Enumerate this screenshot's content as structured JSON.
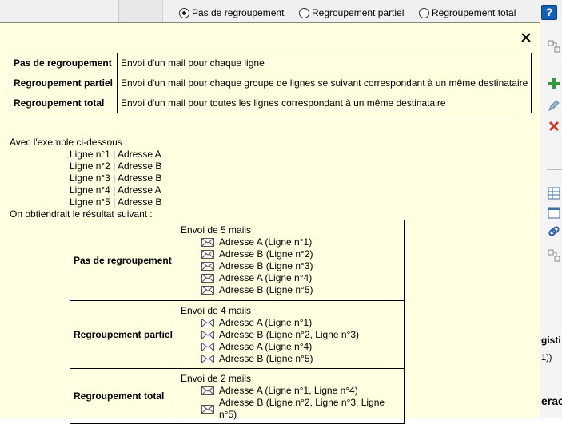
{
  "app": {
    "radios": [
      {
        "label": "Pas de regroupement",
        "checked": true
      },
      {
        "label": "Regroupement partiel",
        "checked": false
      },
      {
        "label": "Regroupement total",
        "checked": false
      }
    ],
    "help_label": "?",
    "right_text": {
      "a": "gisti",
      "b": "1))",
      "c": "erac"
    }
  },
  "tooltip": {
    "definitions": [
      {
        "key": "Pas de regroupement",
        "value": "Envoi d'un mail pour chaque ligne"
      },
      {
        "key": "Regroupement partiel",
        "value": "Envoi d'un mail pour chaque groupe de lignes se suivant correspondant à un même destinataire"
      },
      {
        "key": "Regroupement total",
        "value": "Envoi d'un mail pour toutes les lignes correspondant à un même destinataire"
      }
    ],
    "example_intro": "Avec l'exemple ci-dessous :",
    "example_lines": [
      "Ligne n°1 | Adresse A",
      "Ligne n°2 | Adresse B",
      "Ligne n°3 | Adresse B",
      "Ligne n°4 | Adresse A",
      "Ligne n°5 | Adresse B"
    ],
    "result_intro": "On obtiendrait le résultat suivant :",
    "results": [
      {
        "key": "Pas de regroupement",
        "title": "Envoi de 5 mails",
        "mails": [
          "Adresse A (Ligne n°1)",
          "Adresse B (Ligne n°2)",
          "Adresse B (Ligne n°3)",
          "Adresse A (Ligne n°4)",
          "Adresse B (Ligne n°5)"
        ]
      },
      {
        "key": "Regroupement partiel",
        "title": "Envoi de 4 mails",
        "mails": [
          "Adresse A (Ligne n°1)",
          "Adresse B (Ligne n°2, Ligne n°3)",
          "Adresse A (Ligne n°4)",
          "Adresse B (Ligne n°5)"
        ]
      },
      {
        "key": "Regroupement total",
        "title": "Envoi de 2 mails",
        "mails": [
          "Adresse A (Ligne n°1, Ligne n°4)",
          "Adresse B (Ligne n°2, Ligne n°3, Ligne n°5)"
        ]
      }
    ]
  },
  "colors": {
    "tooltip_bg": "#ffffe1",
    "help_bg": "#1460b8",
    "add_green": "#2e9e3a",
    "delete_red": "#d63a2a"
  }
}
